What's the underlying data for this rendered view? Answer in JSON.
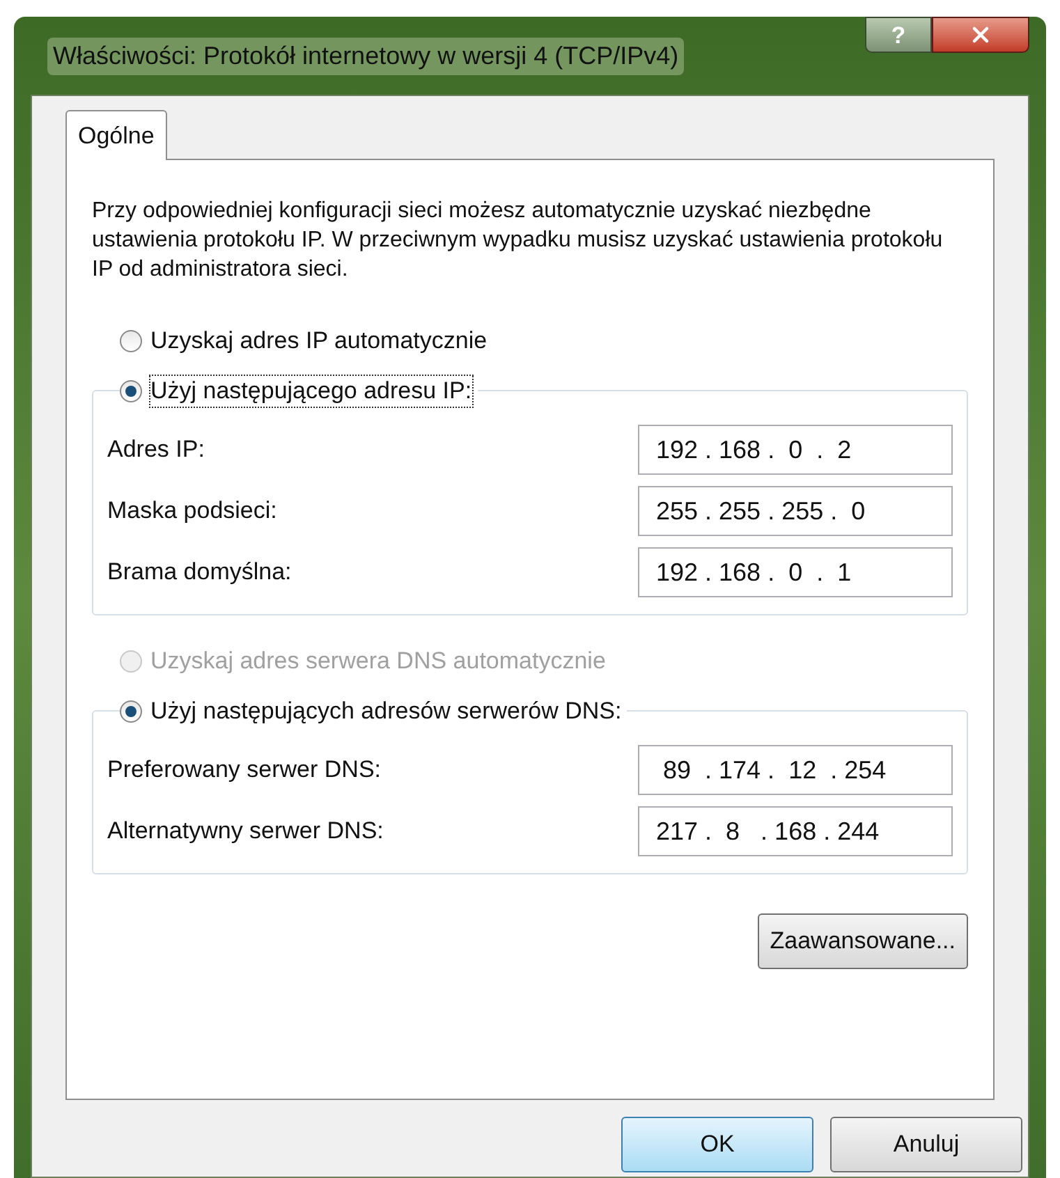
{
  "window": {
    "title": "Właściwości: Protokół internetowy w wersji 4 (TCP/IPv4)",
    "title_buttons": [
      {
        "kind": "help",
        "label": "?"
      },
      {
        "kind": "close"
      }
    ]
  },
  "tabs": [
    {
      "label": "Ogólne",
      "selected": true
    }
  ],
  "description": "Przy odpowiedniej konfiguracji sieci możesz automatycznie uzyskać niezbędne ustawienia protokołu IP. W przeciwnym wypadku musisz uzyskać ustawienia protokołu IP od administratora sieci.",
  "sections": [
    {
      "auto_option": {
        "label": "Uzyskaj adres IP automatycznie",
        "selected": false,
        "disabled": false
      },
      "manual_option": {
        "label": "Użyj następującego adresu IP:",
        "selected": true,
        "focused": true
      },
      "fields": [
        {
          "label": "Adres IP:",
          "value": "192 . 168 .  0  .  2"
        },
        {
          "label": "Maska podsieci:",
          "value": "255 . 255 . 255 .  0"
        },
        {
          "label": "Brama domyślna:",
          "value": "192 . 168 .  0  .  1"
        }
      ]
    },
    {
      "auto_option": {
        "label": "Uzyskaj adres serwera DNS automatycznie",
        "selected": false,
        "disabled": true
      },
      "manual_option": {
        "label": "Użyj następujących adresów serwerów DNS:",
        "selected": true,
        "focused": false
      },
      "fields": [
        {
          "label": "Preferowany serwer DNS:",
          "value": " 89  . 174 .  12  . 254"
        },
        {
          "label": "Alternatywny serwer DNS:",
          "value": "217 .  8   . 168 . 244"
        }
      ]
    }
  ],
  "advanced_button": "Zaawansowane...",
  "buttons": [
    {
      "label": "OK",
      "default": true
    },
    {
      "label": "Anuluj",
      "default": false
    }
  ]
}
